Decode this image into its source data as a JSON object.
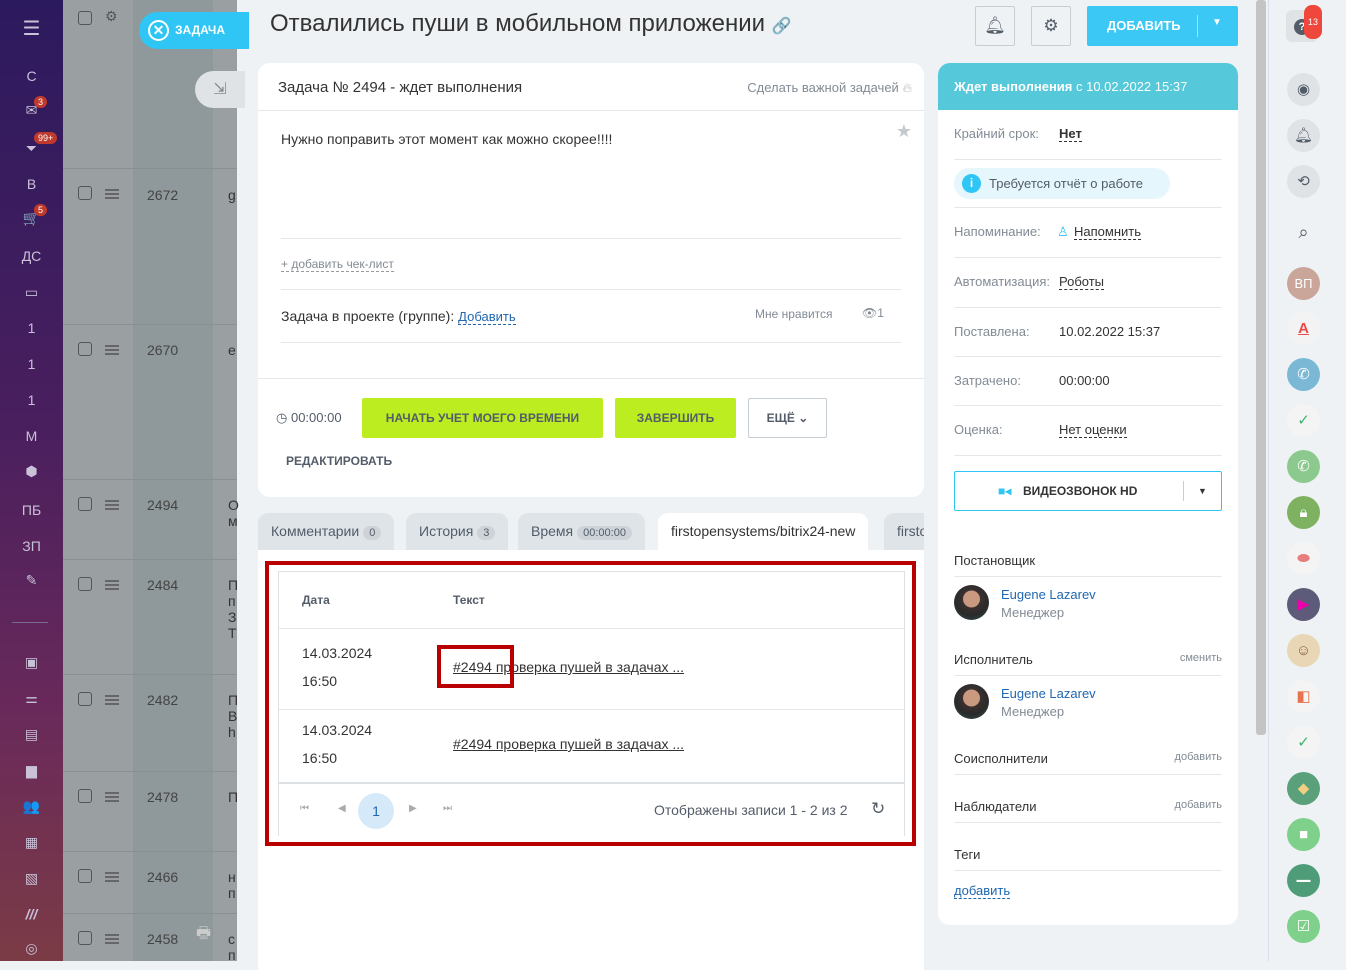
{
  "sidebar": {
    "items": [
      {
        "label": "С"
      },
      {
        "icon": "mail-icon",
        "badge": "3"
      },
      {
        "icon": "funnel-icon",
        "badge": "99+"
      },
      {
        "label": "В"
      },
      {
        "icon": "cart-icon",
        "badge": "5"
      },
      {
        "label": "ДС"
      },
      {
        "icon": "drive-icon"
      },
      {
        "label": "1"
      },
      {
        "label": "1"
      },
      {
        "label": "1"
      },
      {
        "label": "М"
      },
      {
        "icon": "box-icon"
      },
      {
        "label": "ПБ"
      },
      {
        "label": "ЗП"
      },
      {
        "icon": "edit-doc-icon"
      }
    ],
    "bottom_icons": [
      "vibration-icon",
      "sliders-icon",
      "window-icon",
      "chat-icon",
      "group-icon",
      "calendar-icon",
      "contact-card-icon",
      "stripes-icon",
      "target-icon"
    ]
  },
  "background_list": {
    "rows": [
      {
        "id": "2672",
        "text": "g"
      },
      {
        "id": "2670",
        "text": "e"
      },
      {
        "id": "2494",
        "text": "О\nм"
      },
      {
        "id": "2484",
        "text": "П\nп\nЗ\nТ"
      },
      {
        "id": "2482",
        "text": "П\nВ\nh"
      },
      {
        "id": "2478",
        "text": "П"
      },
      {
        "id": "2466",
        "text": "н\nп"
      },
      {
        "id": "2458",
        "text": "с\nп"
      }
    ]
  },
  "slider": {
    "close_label": "ЗАДАЧА"
  },
  "header": {
    "title": "Отвалились пуши в мобильном приложении",
    "add_label": "ДОБАВИТЬ"
  },
  "task": {
    "heading": "Задача № 2494 - ждет выполнения",
    "make_important": "Сделать важной задачей",
    "description": "Нужно поправить этот момент как можно скорее!!!!",
    "add_checklist": "+ добавить чек-лист",
    "project_label": "Задача в проекте (группе):",
    "project_link": "Добавить",
    "like": "Мне нравится",
    "views": "1",
    "timer": "00:00:00",
    "start_time_btn": "НАЧАТЬ УЧЕТ МОЕГО ВРЕМЕНИ",
    "finish_btn": "ЗАВЕРШИТЬ",
    "more_btn": "ЕЩЁ",
    "edit_btn": "РЕДАКТИРОВАТЬ"
  },
  "tabs": [
    {
      "label": "Комментарии",
      "count": "0"
    },
    {
      "label": "История",
      "count": "3"
    },
    {
      "label": "Время",
      "count": "00:00:00"
    },
    {
      "label": "firstopensystems/bitrix24-new",
      "active": true
    },
    {
      "label": "firsto"
    }
  ],
  "table": {
    "headers": [
      "Дата",
      "Текст"
    ],
    "rows": [
      {
        "date": "14.03.2024",
        "time": "16:50",
        "text": "#2494 проверка пушей в задачах ..."
      },
      {
        "date": "14.03.2024",
        "time": "16:50",
        "text": "#2494 проверка пушей в задачах ..."
      }
    ],
    "pager": {
      "current": "1",
      "summary": "Отображены записи 1 - 2 из 2"
    }
  },
  "details": {
    "status_bold": "Ждет выполнения",
    "status_rest": " с 10.02.2022 15:37",
    "deadline_label": "Крайний срок:",
    "deadline_value": "Нет",
    "report_required": "Требуется отчёт о работе",
    "reminder_label": "Напоминание:",
    "reminder_value": "Напомнить",
    "automation_label": "Автоматизация:",
    "automation_value": "Роботы",
    "created_label": "Поставлена:",
    "created_value": "10.02.2022 15:37",
    "spent_label": "Затрачено:",
    "spent_value": "00:00:00",
    "rating_label": "Оценка:",
    "rating_value": "Нет оценки",
    "video_btn": "ВИДЕОЗВОНОК HD",
    "creator_label": "Постановщик",
    "creator_name": "Eugene Lazarev",
    "creator_role": "Менеджер",
    "assignee_label": "Исполнитель",
    "assignee_change": "сменить",
    "assignee_name": "Eugene Lazarev",
    "assignee_role": "Менеджер",
    "coexec_label": "Соисполнители",
    "coexec_add": "добавить",
    "observers_label": "Наблюдатели",
    "observers_add": "добавить",
    "tags_label": "Теги",
    "tags_add": "добавить"
  },
  "rightbar": {
    "help_badge": "13",
    "avatar_initials": "ВП",
    "alpha_letter": "A"
  },
  "colors": {
    "accent": "#3bc8f5",
    "green": "#bbed21",
    "status": "#55c8d9",
    "highlight": "#b80000"
  }
}
